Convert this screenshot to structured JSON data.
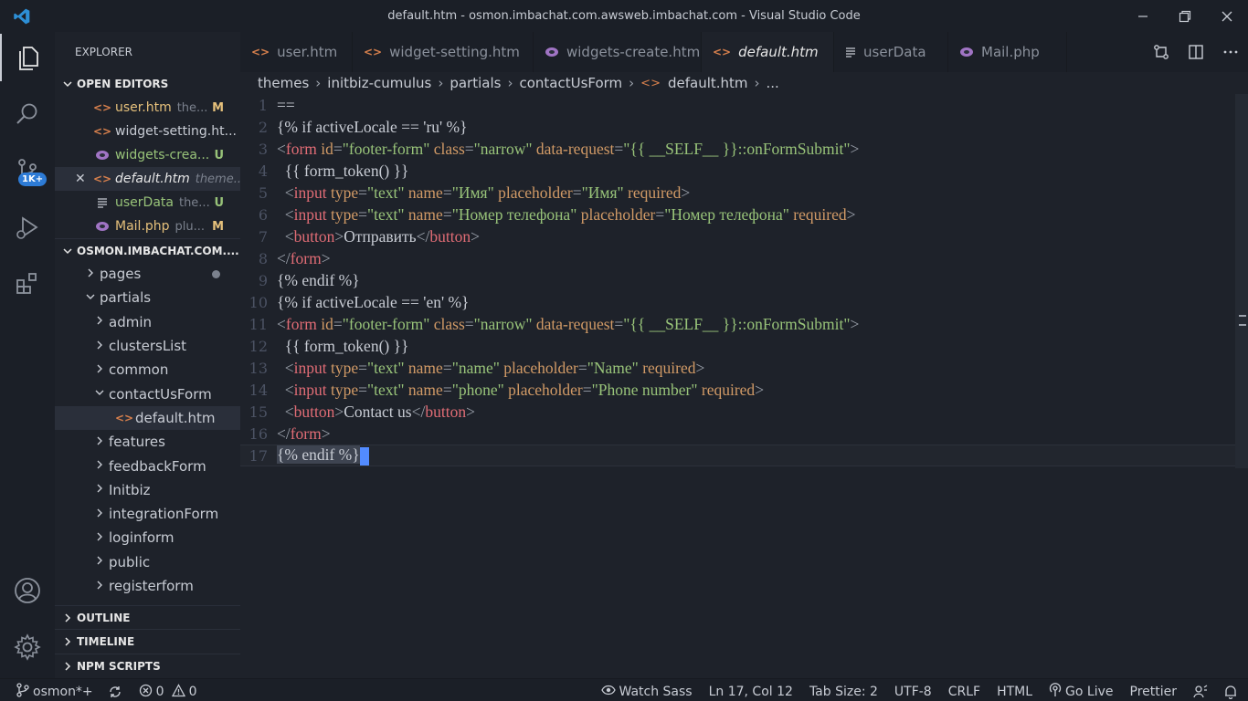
{
  "window": {
    "title": "default.htm - osmon.imbachat.com.awsweb.imbachat.com - Visual Studio Code"
  },
  "activity_bar": {
    "items": [
      "explorer-icon",
      "search-icon",
      "source-control-icon",
      "debug-icon",
      "extensions-icon"
    ],
    "scm_badge": "1K+",
    "bottom": [
      "account-icon",
      "settings-gear-icon"
    ]
  },
  "sidebar": {
    "title": "EXPLORER",
    "open_editors": {
      "header": "OPEN EDITORS",
      "items": [
        {
          "name": "user.htm",
          "path": "the...",
          "status": "M",
          "name_color": "#e5c07b",
          "status_color": "#e5c07b",
          "icon": "html-icon"
        },
        {
          "name": "widget-setting.ht...",
          "path": "",
          "status": "",
          "name_color": "#c8ccd4",
          "status_color": "#c8ccd4",
          "icon": "html-icon"
        },
        {
          "name": "widgets-crea...",
          "path": "",
          "status": "U",
          "name_color": "#98c379",
          "status_color": "#98c379",
          "icon": "php-icon"
        },
        {
          "name": "default.htm",
          "path": "theme...",
          "status": "",
          "name_color": "#e6e6e6",
          "status_color": "#c8ccd4",
          "icon": "html-icon"
        },
        {
          "name": "userData",
          "path": "the...",
          "status": "U",
          "name_color": "#98c379",
          "status_color": "#98c379",
          "icon": "lines-icon"
        },
        {
          "name": "Mail.php",
          "path": "plu...",
          "status": "M",
          "name_color": "#e5c07b",
          "status_color": "#e5c07b",
          "icon": "php-icon"
        }
      ]
    },
    "workspace": {
      "header": "OSMON.IMBACHAT.COM....",
      "items": [
        {
          "label": "pages",
          "depth": 0,
          "open": false
        },
        {
          "label": "partials",
          "depth": 0,
          "open": true
        },
        {
          "label": "admin",
          "depth": 1,
          "open": false
        },
        {
          "label": "clustersList",
          "depth": 1,
          "open": false
        },
        {
          "label": "common",
          "depth": 1,
          "open": false
        },
        {
          "label": "contactUsForm",
          "depth": 1,
          "open": true
        },
        {
          "label": "default.htm",
          "depth": 2,
          "file": true
        },
        {
          "label": "features",
          "depth": 1,
          "open": false
        },
        {
          "label": "feedbackForm",
          "depth": 1,
          "open": false
        },
        {
          "label": "Initbiz",
          "depth": 1,
          "open": false
        },
        {
          "label": "integrationForm",
          "depth": 1,
          "open": false
        },
        {
          "label": "loginform",
          "depth": 1,
          "open": false
        },
        {
          "label": "public",
          "depth": 1,
          "open": false
        },
        {
          "label": "registerform",
          "depth": 1,
          "open": false
        }
      ]
    },
    "bottom_sections": [
      "OUTLINE",
      "TIMELINE",
      "NPM SCRIPTS"
    ]
  },
  "tabs": [
    {
      "label": "user.htm",
      "icon": "html-icon",
      "active": false
    },
    {
      "label": "widget-setting.htm",
      "icon": "html-icon",
      "active": false
    },
    {
      "label": "widgets-create.htm",
      "icon": "php-icon",
      "active": false
    },
    {
      "label": "default.htm",
      "icon": "html-icon",
      "active": true
    },
    {
      "label": "userData",
      "icon": "lines-icon",
      "active": false
    },
    {
      "label": "Mail.php",
      "icon": "php-icon",
      "active": false
    }
  ],
  "breadcrumb": [
    "themes",
    "initbiz-cumulus",
    "partials",
    "contactUsForm",
    "default.htm",
    "..."
  ],
  "editor": {
    "lines": [
      "==",
      "{% if activeLocale == 'ru' %}",
      "<form id=\"footer-form\" class=\"narrow\" data-request=\"{{ __SELF__ }}::onFormSubmit\">",
      "  {{ form_token() }}",
      "  <input type=\"text\" name=\"Имя\" placeholder=\"Имя\" required>",
      "  <input type=\"text\" name=\"Номер телефона\" placeholder=\"Номер телефона\" required>",
      "  <button>Отправить</button>",
      "</form>",
      "{% endif %}",
      "{% if activeLocale == 'en' %}",
      "<form id=\"footer-form\" class=\"narrow\" data-request=\"{{ __SELF__ }}::onFormSubmit\">",
      "  {{ form_token() }}",
      "  <input type=\"text\" name=\"name\" placeholder=\"Name\" required>",
      "  <input type=\"text\" name=\"phone\" placeholder=\"Phone number\" required>",
      "  <button>Contact us</button>",
      "</form>",
      "{% endif %}"
    ],
    "current_line": 17
  },
  "statusbar": {
    "branch": "osmon*+",
    "errors": "0",
    "warnings": "0",
    "watch_sass": "Watch Sass",
    "position": "Ln 17, Col 12",
    "tab_size": "Tab Size: 2",
    "encoding": "UTF-8",
    "eol": "CRLF",
    "language": "HTML",
    "go_live": "Go Live",
    "formatter": "Prettier"
  },
  "colors": {
    "tag": "#e06c75",
    "attr": "#d19a66",
    "string": "#98c379",
    "accent": "#528bff"
  }
}
